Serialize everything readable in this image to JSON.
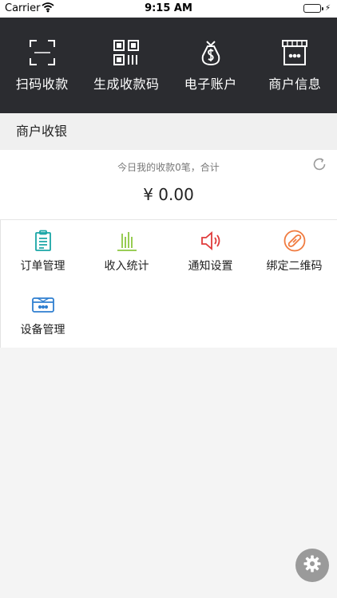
{
  "status_bar": {
    "carrier": "Carrier",
    "time": "9:15 AM"
  },
  "top_actions": [
    {
      "label": "扫码收款",
      "icon": "scan-icon"
    },
    {
      "label": "生成收款码",
      "icon": "qr-code-icon"
    },
    {
      "label": "电子账户",
      "icon": "money-bag-icon"
    },
    {
      "label": "商户信息",
      "icon": "store-icon"
    }
  ],
  "section": {
    "title": "商户收银"
  },
  "summary": {
    "caption": "今日我的收款0笔，合计",
    "amount": "¥ 0.00"
  },
  "features": [
    {
      "label": "订单管理",
      "icon": "clipboard-icon",
      "color": "#1aa6a6"
    },
    {
      "label": "收入统计",
      "icon": "bar-stats-icon",
      "color": "#8cc63f"
    },
    {
      "label": "通知设置",
      "icon": "speaker-icon",
      "color": "#e03b3b"
    },
    {
      "label": "绑定二维码",
      "icon": "link-icon",
      "color": "#f07b3f"
    },
    {
      "label": "设备管理",
      "icon": "device-icon",
      "color": "#2f7fd0"
    }
  ],
  "colors": {
    "dark_bar": "#2b2c30",
    "fab": "#9a9a9a"
  }
}
